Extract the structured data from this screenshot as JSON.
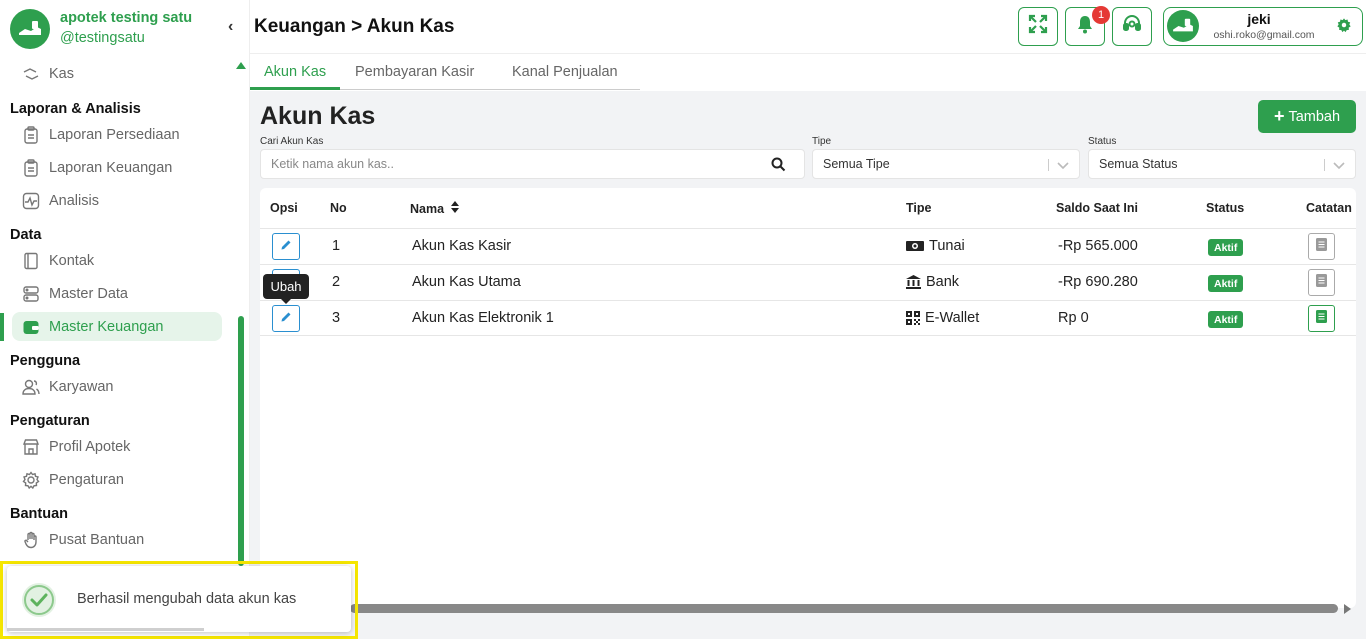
{
  "brand": {
    "name": "apotek testing satu",
    "handle": "@testingsatu"
  },
  "sidebar": {
    "collapse": "‹",
    "items": [
      {
        "type": "item",
        "label": "Kas",
        "icon": "cash-flow-icon"
      },
      {
        "type": "section",
        "label": "Laporan & Analisis"
      },
      {
        "type": "item",
        "label": "Laporan Persediaan",
        "icon": "clipboard-icon"
      },
      {
        "type": "item",
        "label": "Laporan Keuangan",
        "icon": "clipboard-icon"
      },
      {
        "type": "item",
        "label": "Analisis",
        "icon": "pulse-icon"
      },
      {
        "type": "section",
        "label": "Data"
      },
      {
        "type": "item",
        "label": "Kontak",
        "icon": "contact-book-icon"
      },
      {
        "type": "item",
        "label": "Master Data",
        "icon": "database-icon"
      },
      {
        "type": "item",
        "label": "Master Keuangan",
        "icon": "wallet-icon",
        "active": true
      },
      {
        "type": "section",
        "label": "Pengguna"
      },
      {
        "type": "item",
        "label": "Karyawan",
        "icon": "users-icon"
      },
      {
        "type": "section",
        "label": "Pengaturan"
      },
      {
        "type": "item",
        "label": "Profil Apotek",
        "icon": "store-icon"
      },
      {
        "type": "item",
        "label": "Pengaturan",
        "icon": "gear-icon"
      },
      {
        "type": "section",
        "label": "Bantuan"
      },
      {
        "type": "item",
        "label": "Pusat Bantuan",
        "icon": "hand-icon"
      }
    ]
  },
  "header": {
    "breadcrumb": "Keuangan > Akun Kas",
    "notification_count": "1",
    "user": {
      "name": "jeki",
      "email": "oshi.roko@gmail.com"
    }
  },
  "tabs": [
    {
      "label": "Akun Kas",
      "active": true
    },
    {
      "label": "Pembayaran Kasir",
      "active": false
    },
    {
      "label": "Kanal Penjualan",
      "active": false
    }
  ],
  "main": {
    "title": "Akun Kas",
    "add_button": "Tambah",
    "filters": {
      "search_label": "Cari Akun Kas",
      "search_placeholder": "Ketik nama akun kas..",
      "type_label": "Tipe",
      "type_value": "Semua Tipe",
      "status_label": "Status",
      "status_value": "Semua Status"
    },
    "table": {
      "columns": [
        "Opsi",
        "No",
        "Nama",
        "Tipe",
        "Saldo Saat Ini",
        "Status",
        "Catatan"
      ],
      "rows": [
        {
          "no": "1",
          "nama": "Akun Kas Kasir",
          "tipe": "Tunai",
          "tipe_icon": "cash-icon",
          "saldo": "-Rp 565.000",
          "status": "Aktif",
          "has_note": false
        },
        {
          "no": "2",
          "nama": "Akun Kas Utama",
          "tipe": "Bank",
          "tipe_icon": "bank-icon",
          "saldo": "-Rp 690.280",
          "status": "Aktif",
          "has_note": false
        },
        {
          "no": "3",
          "nama": "Akun Kas Elektronik 1",
          "tipe": "E-Wallet",
          "tipe_icon": "qr-code-icon",
          "saldo": "Rp 0",
          "status": "Aktif",
          "has_note": true
        }
      ]
    },
    "tooltip": "Ubah"
  },
  "toast": {
    "message": "Berhasil mengubah data akun kas"
  },
  "colors": {
    "primary": "#2e9f4e",
    "edit": "#2a8fd0",
    "danger": "#e53935",
    "highlight": "#f5e600"
  }
}
